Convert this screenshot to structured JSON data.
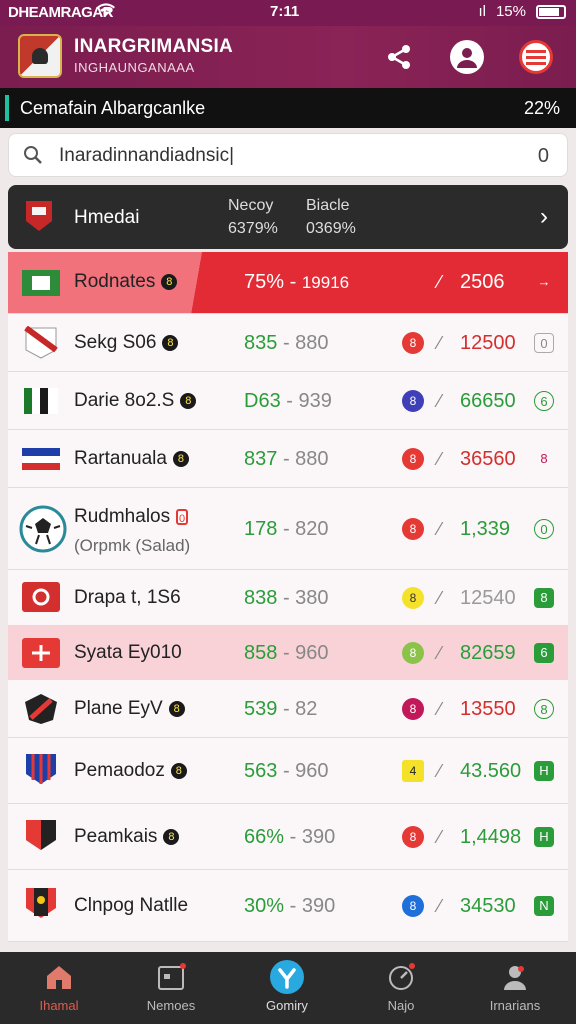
{
  "status": {
    "carrier": "DHEAMRAGAR",
    "time": "7:11",
    "signal": "ıl",
    "battery": "15%"
  },
  "header": {
    "brand": "INARGRIMANSIA",
    "subtitle": "INGHAUNGANAAA"
  },
  "ticker": {
    "league": "Cemafain Albargcanlke",
    "percent": "22%"
  },
  "search": {
    "value": "Inaradinnandiadnsic|",
    "count": "0"
  },
  "featured": {
    "title": "Hmedai",
    "col1_head": "Necoy",
    "col1_val": "6379%",
    "col2_head": "Biacle",
    "col2_val": "0369%"
  },
  "rows": [
    {
      "name": "Rodnates",
      "dot": "8",
      "odds_a": "75%",
      "odds_b": "19916",
      "amount": "2506",
      "action": "→",
      "badge": ""
    },
    {
      "name": "Sekg S06",
      "dot": "8",
      "odds_a": "835",
      "odds_b": "880",
      "amount": "12500",
      "action": "0",
      "badge": "8"
    },
    {
      "name": "Darie 8o2.S",
      "dot": "8",
      "odds_a": "D63",
      "odds_b": "939",
      "amount": "66650",
      "action": "6",
      "badge": "8"
    },
    {
      "name": "Rartanuala",
      "dot": "8",
      "odds_a": "837",
      "odds_b": "880",
      "amount": "36560",
      "action": "8",
      "badge": "8"
    },
    {
      "name": "Rudmhalos",
      "sub": "(Orpmk (Salad)",
      "dot": "0",
      "odds_a": "178",
      "odds_b": "820",
      "amount": "1,339",
      "action": "0",
      "badge": "8"
    },
    {
      "name": "Drapa t, 1S6",
      "dot": "",
      "odds_a": "838",
      "odds_b": "380",
      "amount": "12540",
      "action": "8",
      "badge": "8"
    },
    {
      "name": "Syata Ey010",
      "dot": "",
      "odds_a": "858",
      "odds_b": "960",
      "amount": "82659",
      "action": "6",
      "badge": "8"
    },
    {
      "name": "Plane EyV",
      "dot": "8",
      "odds_a": "539",
      "odds_b": "82",
      "amount": "13550",
      "action": "8",
      "badge": "8"
    },
    {
      "name": "Pemaodoz",
      "dot": "8",
      "odds_a": "563",
      "odds_b": "960",
      "amount": "43.560",
      "action": "H",
      "badge": "4"
    },
    {
      "name": "Peamkais",
      "dot": "8",
      "odds_a": "66%",
      "odds_b": "390",
      "amount": "1,4498",
      "action": "H",
      "badge": "8"
    },
    {
      "name": "Clnpog Natlle",
      "dot": "",
      "odds_a": "30%",
      "odds_b": "390",
      "amount": "34530",
      "action": "N",
      "badge": "8"
    }
  ],
  "nav": [
    {
      "label": "Ihamal",
      "icon": "home-icon"
    },
    {
      "label": "Nemoes",
      "icon": "calendar-icon"
    },
    {
      "label": "Gomiry",
      "icon": "soccer-ball-icon"
    },
    {
      "label": "Najo",
      "icon": "target-icon"
    },
    {
      "label": "Irnarians",
      "icon": "profile-icon"
    }
  ],
  "colors": {
    "header": "#7b1d4f",
    "accent": "#e22b35",
    "odds_green": "#2a9d3a",
    "nav_bg": "#2a2a2a"
  }
}
